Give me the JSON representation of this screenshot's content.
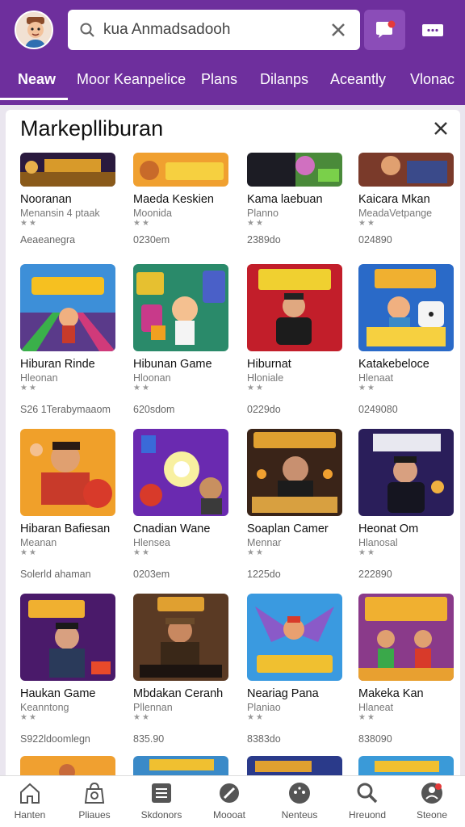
{
  "header": {
    "search": {
      "value": "kua Anmadsadooh"
    },
    "tabs": [
      {
        "label": "Neaw",
        "active": true
      },
      {
        "label": "Moor Keanpelice",
        "active": false
      },
      {
        "label": "Plans",
        "active": false
      },
      {
        "label": "Dilanps",
        "active": false
      },
      {
        "label": "Aceantly",
        "active": false
      },
      {
        "label": "Vlonac",
        "active": false
      }
    ],
    "accent_color": "#6e2f9d"
  },
  "panel": {
    "title": "Markeplliburan",
    "rows": [
      [
        {
          "title": "Nooranan",
          "subtitle": "Menansin 4 ptaak",
          "meta": "Aeaeanegra",
          "icon": "fantasy-game-thumb"
        },
        {
          "title": "Maeda Keskien",
          "subtitle": "Moonida",
          "meta": "0230em",
          "icon": "doges-game-thumb"
        },
        {
          "title": "Kama laebuan",
          "subtitle": "Planno",
          "meta": "2389do",
          "icon": "casino-game-thumb"
        },
        {
          "title": "Kaicara Mkan",
          "subtitle": "MeadaVetpange",
          "meta": "024890",
          "icon": "heroes-game-thumb"
        }
      ],
      [
        {
          "title": "Hiburan Rinde",
          "subtitle": "Hleonan",
          "meta": "S26 1Terabymaaom",
          "icon": "runner-game-thumb"
        },
        {
          "title": "Hibunan Game",
          "subtitle": "Hloonan",
          "meta": "620sdom",
          "icon": "arcade-game-thumb"
        },
        {
          "title": "Hiburnat",
          "subtitle": "Hloniale",
          "meta": "0229do",
          "icon": "dumo-game-thumb"
        },
        {
          "title": "Katakebeloce",
          "subtitle": "Hlenaat",
          "meta": "0249080",
          "icon": "dice-game-thumb"
        }
      ],
      [
        {
          "title": "Hibaran Bafiesan",
          "subtitle": "Meanan",
          "meta": "Solerld ahaman",
          "icon": "champion-game-thumb"
        },
        {
          "title": "Cnadian Wane",
          "subtitle": "Hlensea",
          "meta": "0203em",
          "icon": "magic-game-thumb"
        },
        {
          "title": "Soaplan Camer",
          "subtitle": "Mennar",
          "meta": "1225do",
          "icon": "gamaker-game-thumb"
        },
        {
          "title": "Heonat Om",
          "subtitle": "Hlanosal",
          "meta": "222890",
          "icon": "killer-game-thumb"
        }
      ],
      [
        {
          "title": "Haukan Game",
          "subtitle": "Keanntong",
          "meta": "S922ldoomlegn",
          "icon": "shiedae-game-thumb"
        },
        {
          "title": "Mbdakan Ceranh",
          "subtitle": "Pllennan",
          "meta": "835.90",
          "icon": "sansebian-game-thumb"
        },
        {
          "title": "Neariag Pana",
          "subtitle": "Planiao",
          "meta": "8383do",
          "icon": "winged-game-thumb"
        },
        {
          "title": "Makeka Kan",
          "subtitle": "Hlaneat",
          "meta": "838090",
          "icon": "festival-game-thumb"
        }
      ]
    ]
  },
  "bottom_nav": [
    {
      "label": "Hanten",
      "icon": "home-icon"
    },
    {
      "label": "Pliaues",
      "icon": "bag-icon"
    },
    {
      "label": "Skdonors",
      "icon": "list-icon"
    },
    {
      "label": "Moooat",
      "icon": "compass-icon"
    },
    {
      "label": "Nenteus",
      "icon": "controller-icon"
    },
    {
      "label": "Hreuond",
      "icon": "search-icon"
    },
    {
      "label": "Steone",
      "icon": "profile-icon"
    }
  ]
}
